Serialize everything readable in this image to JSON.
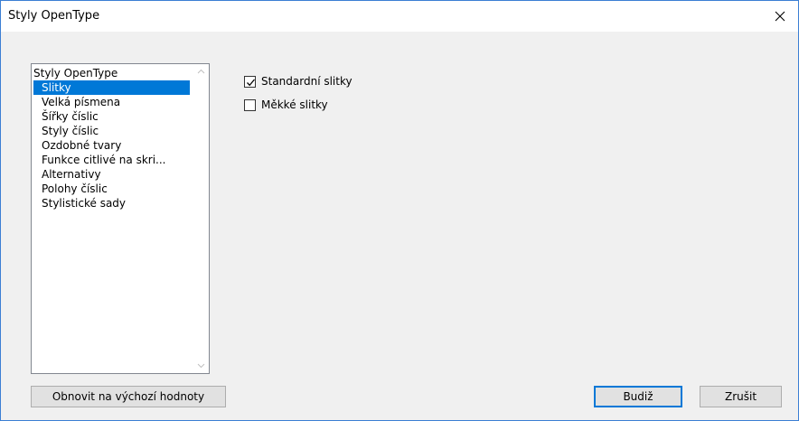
{
  "window": {
    "title": "Styly OpenType",
    "close_icon": "close-icon"
  },
  "features_list": {
    "header": "Styly OpenType",
    "items": [
      {
        "label": "Slitky",
        "selected": true
      },
      {
        "label": "Velká písmena",
        "selected": false
      },
      {
        "label": "Šířky číslic",
        "selected": false
      },
      {
        "label": "Styly číslic",
        "selected": false
      },
      {
        "label": "Ozdobné tvary",
        "selected": false
      },
      {
        "label": "Funkce citlivé na skri...",
        "selected": false
      },
      {
        "label": "Alternativy",
        "selected": false
      },
      {
        "label": "Polohy číslic",
        "selected": false
      },
      {
        "label": "Stylistické sady",
        "selected": false
      }
    ]
  },
  "options": [
    {
      "label": "Standardní slitky",
      "checked": true
    },
    {
      "label": "Měkké slitky",
      "checked": false
    }
  ],
  "buttons": {
    "reset": "Obnovit na výchozí hodnoty",
    "ok": "Budiž",
    "cancel": "Zrušit"
  },
  "colors": {
    "accent": "#0078d7",
    "window_border": "#3b7fd4",
    "dialog_bg": "#f0f0f0"
  }
}
